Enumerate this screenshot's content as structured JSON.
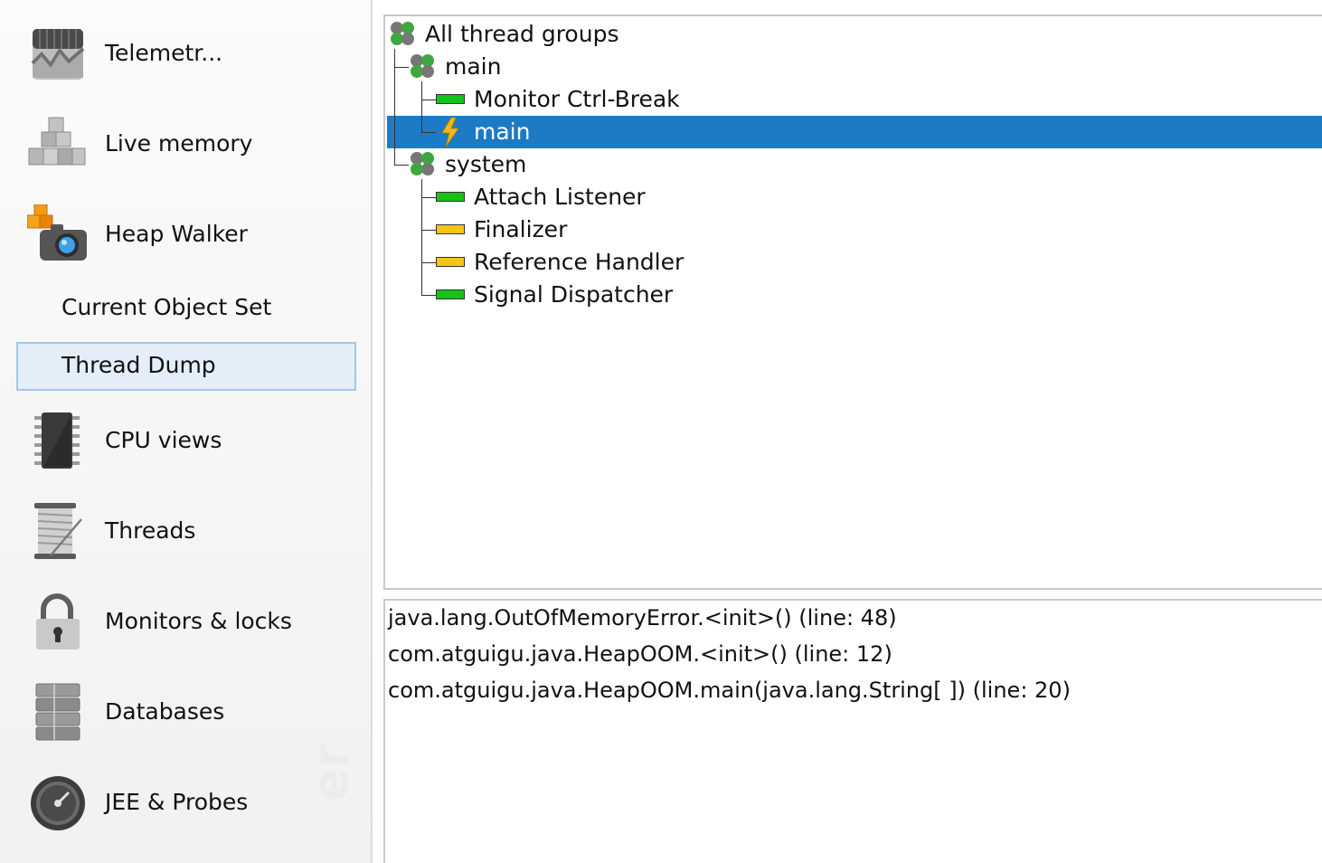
{
  "sidebar": {
    "items": [
      {
        "label": "Telemetr...",
        "icon": "telemetry-chart-icon"
      },
      {
        "label": "Live memory",
        "icon": "live-memory-blocks-icon"
      },
      {
        "label": "Heap Walker",
        "icon": "heap-walker-camera-icon"
      },
      {
        "label": "CPU views",
        "icon": "cpu-chip-icon"
      },
      {
        "label": "Threads",
        "icon": "thread-spool-icon"
      },
      {
        "label": "Monitors & locks",
        "icon": "padlock-icon"
      },
      {
        "label": "Databases",
        "icon": "database-stack-icon"
      },
      {
        "label": "JEE & Probes",
        "icon": "speedometer-icon"
      }
    ],
    "sub_items": [
      {
        "label": "Current Object Set"
      },
      {
        "label": "Thread Dump",
        "selected": true
      }
    ],
    "watermark": "er"
  },
  "thread_tree": {
    "root": {
      "label": "All thread groups",
      "icon": "thread-group-icon"
    },
    "groups": [
      {
        "label": "main",
        "icon": "thread-group-icon",
        "threads": [
          {
            "label": "Monitor Ctrl-Break",
            "state": "runnable",
            "icon": "thread-state-green-icon"
          },
          {
            "label": "main",
            "state": "current",
            "icon": "lightning-icon",
            "selected": true
          }
        ]
      },
      {
        "label": "system",
        "icon": "thread-group-icon",
        "threads": [
          {
            "label": "Attach Listener",
            "state": "runnable",
            "icon": "thread-state-green-icon"
          },
          {
            "label": "Finalizer",
            "state": "waiting",
            "icon": "thread-state-yellow-icon"
          },
          {
            "label": "Reference Handler",
            "state": "waiting",
            "icon": "thread-state-yellow-icon"
          },
          {
            "label": "Signal Dispatcher",
            "state": "runnable",
            "icon": "thread-state-green-icon"
          }
        ]
      }
    ]
  },
  "stack_trace": {
    "lines": [
      "java.lang.OutOfMemoryError.<init>() (line: 48)",
      "com.atguigu.java.HeapOOM.<init>() (line: 12)",
      "com.atguigu.java.HeapOOM.main(java.lang.String[ ]) (line: 20)"
    ]
  },
  "colors": {
    "selection": "#1d7ac5",
    "selection_text": "#ffffff",
    "sidebar_selected_bg": "#e3eef9",
    "sidebar_selected_border": "#a7c6e7",
    "state_runnable": "#14c314",
    "state_waiting": "#f5c518",
    "lightning": "#f2b90f"
  }
}
